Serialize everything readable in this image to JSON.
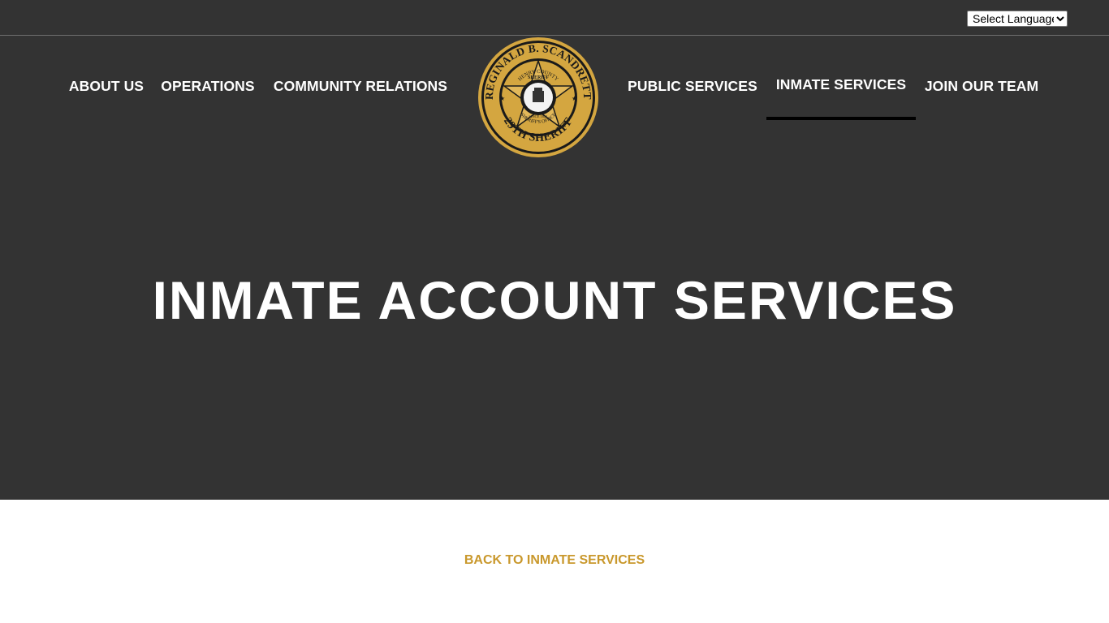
{
  "language_select": {
    "selected": "Select Language",
    "options": [
      "Select Language"
    ]
  },
  "nav": {
    "about": "ABOUT US",
    "operations": "OPERATIONS",
    "community": "COMMUNITY RELATIONS",
    "public": "PUBLIC SERVICES",
    "inmate": "INMATE SERVICES",
    "join": "JOIN OUR TEAM",
    "active": "INMATE SERVICES"
  },
  "logo": {
    "icon": "sheriff-badge-logo-icon",
    "top_text": "REGINALD B. SCANDRETT",
    "county": "HENRY COUNTY",
    "title": "SHERIFF",
    "since": "SINCE 1821",
    "office": "SHERIFF'S OFFICE",
    "bottom_text": "29TH SHERIFF",
    "colors": {
      "gold": "#d4a640",
      "dark": "#1a1a1a"
    }
  },
  "hero": {
    "title": "INMATE ACCOUNT SERVICES"
  },
  "content": {
    "back_link": "BACK TO INMATE SERVICES"
  },
  "colors": {
    "header_bg": "#333333",
    "accent": "#c9982c",
    "nav_text": "#ffffff",
    "active_underline": "#000000"
  }
}
